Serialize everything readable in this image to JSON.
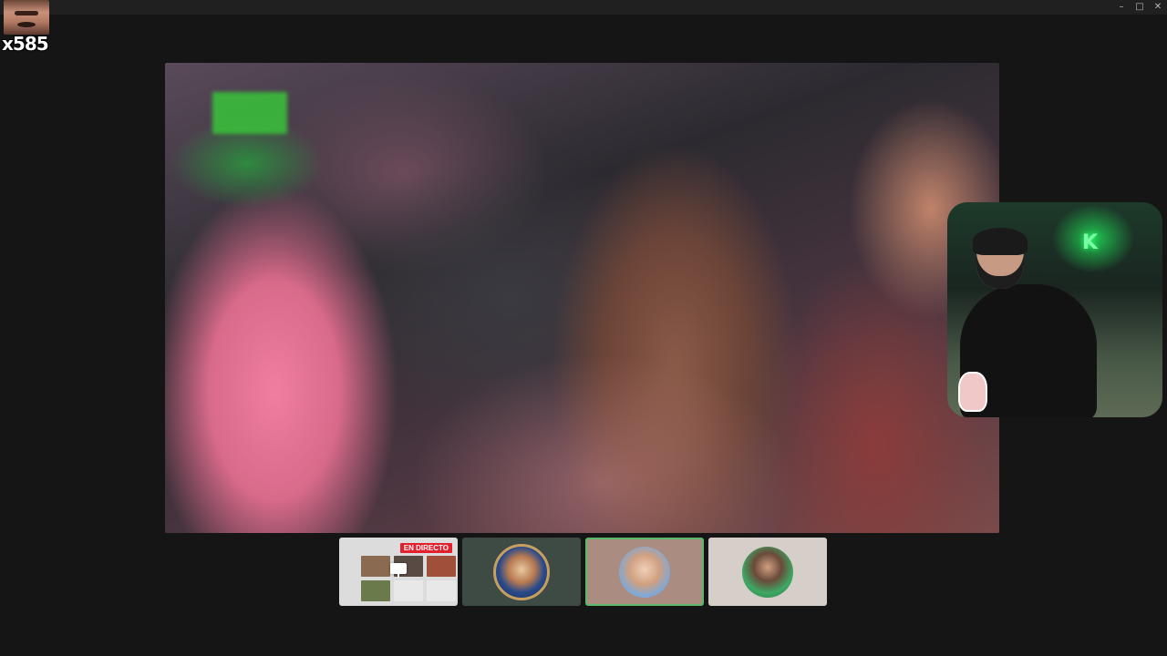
{
  "overlay": {
    "counter": "x585"
  },
  "window": {
    "minimize": "–",
    "maximize": "□",
    "close": "✕"
  },
  "participants": [
    {
      "type": "screen-share",
      "badge": "EN DIRECTO"
    },
    {
      "type": "avatar"
    },
    {
      "type": "avatar",
      "active": true,
      "active_color": "#5bb96a"
    },
    {
      "type": "avatar"
    }
  ]
}
